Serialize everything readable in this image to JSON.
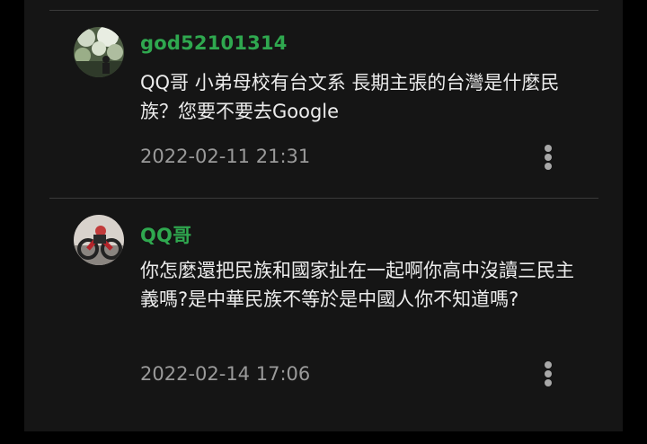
{
  "comments": [
    {
      "username": "god52101314",
      "text": "QQ哥 小弟母校有台文系 長期主張的台灣是什麼民族？您要不要去Google",
      "timestamp": "2022-02-11 21:31",
      "more_icon": "more-vertical-icon"
    },
    {
      "username": "QQ哥",
      "text": "你怎麼還把民族和國家扯在一起啊你高中沒讀三民主義嗎?是中華民族不等於是中國人你不知道嗎?",
      "timestamp": "2022-02-14 17:06",
      "more_icon": "more-vertical-icon"
    }
  ],
  "colors": {
    "background": "#000000",
    "panel": "#151515",
    "username": "#2fa84f",
    "text": "#ececec",
    "timestamp": "#9a9a9a",
    "divider": "#3a3a3a"
  }
}
